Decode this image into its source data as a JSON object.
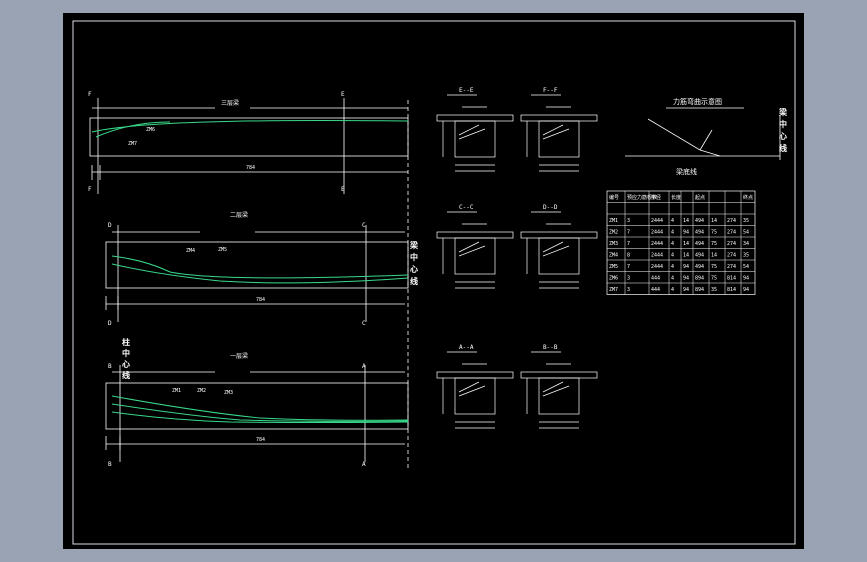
{
  "colors": {
    "background_outer": "#9aa3b3",
    "sheet": "#000000",
    "line": "#ffffff",
    "curve": "#39d98a",
    "frame": "#d7dde6"
  },
  "beams": [
    {
      "title": "三层梁",
      "left_label": "F",
      "right_label": "E",
      "tendons": [
        "ZM6",
        "ZM7"
      ],
      "dimension": "784"
    },
    {
      "title": "二层梁",
      "left_label": "D",
      "right_label": "C",
      "tendons": [
        "ZM4",
        "ZM5"
      ],
      "dimension": "784"
    },
    {
      "title": "一层梁",
      "left_label": "B",
      "right_label": "A",
      "tendons": [
        "ZM1",
        "ZM2",
        "ZM3"
      ],
      "dimension": "784"
    }
  ],
  "centerline_label": "梁中心线",
  "column_centerline_label": "柱中心线",
  "sections": [
    {
      "title": "E--E"
    },
    {
      "title": "F--F"
    },
    {
      "title": "C--C"
    },
    {
      "title": "D--D"
    },
    {
      "title": "A--A"
    },
    {
      "title": "B--B"
    }
  ],
  "sketch": {
    "title": "力筋弯曲示意图",
    "axis_x": "梁底线",
    "axis_y": "梁中心线"
  },
  "table": {
    "headers": [
      "编号",
      "预应力筋根数",
      "半径",
      "长度",
      "",
      "起点",
      "",
      "",
      "终点"
    ],
    "rows": [
      [
        "ZM1",
        "3",
        "2444",
        "4",
        "14",
        "494",
        "14",
        "274",
        "35"
      ],
      [
        "ZM2",
        "7",
        "2444",
        "4",
        "94",
        "494",
        "75",
        "274",
        "54"
      ],
      [
        "ZM3",
        "7",
        "2444",
        "4",
        "14",
        "494",
        "75",
        "274",
        "34"
      ],
      [
        "ZM4",
        "8",
        "2444",
        "4",
        "14",
        "494",
        "14",
        "274",
        "35"
      ],
      [
        "ZM5",
        "7",
        "2444",
        "4",
        "94",
        "494",
        "75",
        "274",
        "54"
      ],
      [
        "ZM6",
        "3",
        "444",
        "4",
        "94",
        "894",
        "75",
        "814",
        "94"
      ],
      [
        "ZM7",
        "3",
        "444",
        "4",
        "94",
        "894",
        "35",
        "814",
        "94"
      ]
    ]
  }
}
